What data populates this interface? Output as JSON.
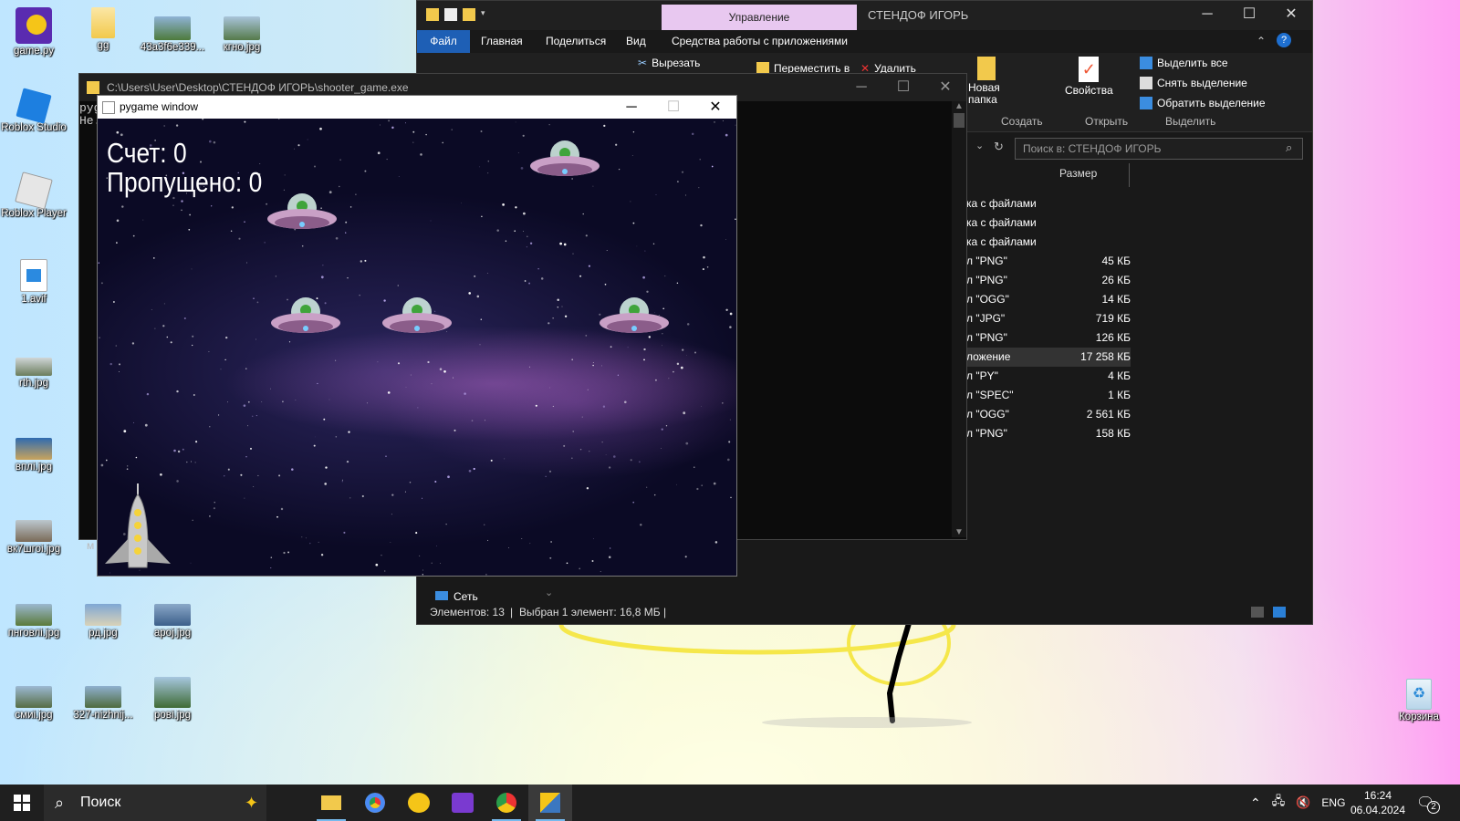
{
  "desktop_icons": [
    {
      "label": "game.py"
    },
    {
      "label": "gg"
    },
    {
      "label": "43a3f6e339..."
    },
    {
      "label": "кгно.jpg"
    },
    {
      "label": "Roblox Studio"
    },
    {
      "label": "Roblox Player"
    },
    {
      "label": "1.avif"
    },
    {
      "label": "rth.jpg"
    },
    {
      "label": "вплі.jpg"
    },
    {
      "label": "вк7шгоі.jpg"
    },
    {
      "label": "пнговлі.jpg"
    },
    {
      "label": "рд.jpg"
    },
    {
      "label": "apoj.jpg"
    },
    {
      "label": "смиі.jpg"
    },
    {
      "label": "327-nizhnij..."
    },
    {
      "label": "рові.jpg"
    },
    {
      "label": "Корзина"
    }
  ],
  "explorer": {
    "context_tab": "Управление",
    "title": "СТЕНДОФ ИГОРЬ",
    "tabs": [
      "Файл",
      "Главная",
      "Поделиться",
      "Вид",
      "Средства работы с приложениями"
    ],
    "ribbon": {
      "cut": "Вырезать",
      "move_to": "Переместить в",
      "delete": "Удалить",
      "new_folder": "Новая папка",
      "group_create": "Создать",
      "properties": "Свойства",
      "group_open": "Открыть",
      "select_all": "Выделить все",
      "deselect": "Снять выделение",
      "invert": "Обратить выделение",
      "group_select": "Выделить"
    },
    "search_placeholder": "Поиск в: СТЕНДОФ ИГОРЬ",
    "column_size": "Размер",
    "rows": [
      {
        "type": "ка с файлами",
        "size": ""
      },
      {
        "type": "ка с файлами",
        "size": ""
      },
      {
        "type": "ка с файлами",
        "size": ""
      },
      {
        "type": "л \"PNG\"",
        "size": "45 КБ"
      },
      {
        "type": "л \"PNG\"",
        "size": "26 КБ"
      },
      {
        "type": "л \"OGG\"",
        "size": "14 КБ"
      },
      {
        "type": "л \"JPG\"",
        "size": "719 КБ"
      },
      {
        "type": "л \"PNG\"",
        "size": "126 КБ"
      },
      {
        "type": "ложение",
        "size": "17 258 КБ"
      },
      {
        "type": "л \"PY\"",
        "size": "4 КБ"
      },
      {
        "type": "л \"SPEC\"",
        "size": "1 КБ"
      },
      {
        "type": "л \"OGG\"",
        "size": "2 561 КБ"
      },
      {
        "type": "л \"PNG\"",
        "size": "158 КБ"
      }
    ],
    "nav_network": "Сеть",
    "status_count": "Элементов: 13",
    "status_selected": "Выбран 1 элемент: 16,8 МБ"
  },
  "console": {
    "title": "C:\\Users\\User\\Desktop\\СТЕНДОФ ИГОРЬ\\shooter_game.exe",
    "line1": "pyg",
    "line2": "He.",
    "side_char": "м"
  },
  "pygame": {
    "title": "pygame window",
    "score": "Счет: 0",
    "missed": "Пропущено: 0"
  },
  "taskbar": {
    "search_placeholder": "Поиск",
    "lang": "ENG",
    "time": "16:24",
    "date": "06.04.2024",
    "notifications": "2"
  },
  "colors": {
    "explorer_bg": "#191919",
    "accent_blue": "#1e5fb5",
    "manage_tab": "#e8c8f0",
    "taskbar_bg": "#1f1f1f"
  }
}
